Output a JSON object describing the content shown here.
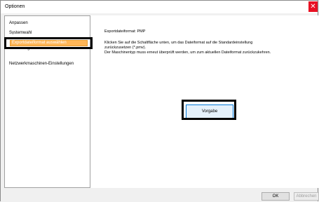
{
  "window": {
    "title": "Optionen",
    "close_glyph": "✕"
  },
  "sidebar": {
    "items": [
      {
        "label": "Anpassen"
      },
      {
        "label": "Systemwahl"
      },
      {
        "label": "Exportdateiformat auswählen",
        "selected": true
      },
      {
        "label": "Einstellungen Benutzerschnittstelle"
      },
      {
        "label": "Netzwerkmaschinen-Einstellungen"
      }
    ]
  },
  "content": {
    "line1": "Exportdateiformat: PMP",
    "line2": "Klicken Sie auf die Schaltfläche unten, um das Dateiformat auf die Standardeinstellung",
    "line3": "zurückzusetzen (*.pmv).",
    "line4": "Der Maschinentyp muss erneut überprüft werden, um zum aktuellen Dateiformat zurückzukehren.",
    "default_button": "Vorgabe"
  },
  "footer": {
    "ok_label": "OK",
    "cancel_label": "Abbrechen"
  },
  "colors": {
    "selection": "#ffb657",
    "close": "#e81123",
    "button_focus": "#0078d7"
  }
}
